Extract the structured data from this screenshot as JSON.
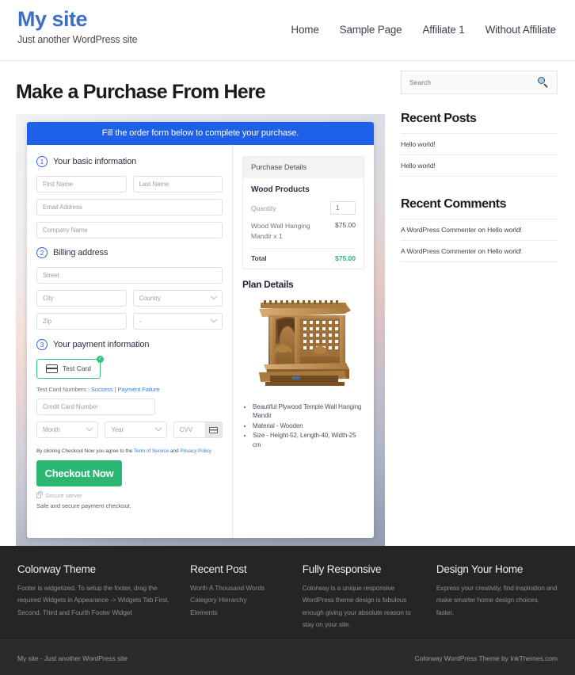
{
  "header": {
    "site_title": "My site",
    "tagline": "Just another WordPress site",
    "nav": [
      {
        "label": "Home"
      },
      {
        "label": "Sample Page"
      },
      {
        "label": "Affiliate 1"
      },
      {
        "label": "Without Affiliate"
      }
    ]
  },
  "page": {
    "title": "Make a Purchase From Here"
  },
  "form": {
    "banner": "Fill the order form below to complete your purchase.",
    "step1": {
      "number": "1",
      "label": "Your basic information",
      "first_name_placeholder": "First Name",
      "last_name_placeholder": "Last Name",
      "email_placeholder": "Email Address",
      "company_placeholder": "Company Name"
    },
    "step2": {
      "number": "2",
      "label": "Billing address",
      "street_placeholder": "Street",
      "city_placeholder": "City",
      "country_placeholder": "Country",
      "zip_placeholder": "Zip",
      "state_placeholder": "-"
    },
    "step3": {
      "number": "3",
      "label": "Your payment information",
      "card_tab_label": "Test Card",
      "card_tab_check": "✓",
      "test_numbers_prefix": "Test Card Numbers : ",
      "test_success": "Success",
      "test_divider": " | ",
      "test_failure": "Payment Failure",
      "card_number_placeholder": "Credit Card Number",
      "month_placeholder": "Month",
      "year_placeholder": "Year",
      "cvv_placeholder": "CVV",
      "agree_prefix": "By clicking Checkout Now you agree to the ",
      "agree_tos": "Term of Service",
      "agree_mid": " and ",
      "agree_privacy": "Privacy Policy",
      "checkout_button": "Checkout Now",
      "secure_server": "Secure server",
      "safe_note": "Safe and secure payment checkout."
    }
  },
  "purchase": {
    "head": "Purchase Details",
    "product": "Wood Products",
    "quantity_label": "Quantity",
    "quantity_value": "1",
    "item_name": "Wood Wall Hanging Mandir x 1",
    "item_price": "$75.00",
    "total_label": "Total",
    "total_value": "$75.00",
    "plan_title": "Plan Details",
    "bullets": [
      "Beautiful Plywood Temple Wall Hanging Mandir",
      "Material - Wooden",
      "Size - Height-52, Length-40, Width-25 cm"
    ]
  },
  "sidebar": {
    "search_placeholder": "Search",
    "recent_posts_title": "Recent Posts",
    "recent_posts": [
      {
        "label": "Hello world!"
      },
      {
        "label": "Hello world!"
      }
    ],
    "recent_comments_title": "Recent Comments",
    "recent_comments": [
      {
        "author": "A WordPress Commenter",
        "on": " on ",
        "post": "Hello world!"
      },
      {
        "author": "A WordPress Commenter",
        "on": " on ",
        "post": "Hello world!"
      }
    ]
  },
  "footer": {
    "columns": [
      {
        "title": "Colorway Theme",
        "text": "Footer is widgetized. To setup the footer, drag the required Widgets in Appearance -> Widgets Tab First, Second, Third and Fourth Footer Widget"
      },
      {
        "title": "Recent Post",
        "items": [
          {
            "label": "Worth A Thousand Words"
          },
          {
            "label": "Category Hierarchy"
          },
          {
            "label": "Elements"
          }
        ]
      },
      {
        "title": "Fully Responsive",
        "text": "Colorway is a unique responsive WordPress theme design is fabulous enough giving your absolute reason to stay on your site."
      },
      {
        "title": "Design Your Home",
        "text": "Express your creativity, find inspiration and make smarter home design choices, faster."
      }
    ],
    "bottom_left": "My site - Just another WordPress site",
    "bottom_right": "Colorway WordPress Theme by InkThemes.com"
  },
  "colors": {
    "brand": "#3f6fc4",
    "banner_blue": "#1f60e8",
    "accent_green": "#2bb673",
    "link_blue": "#3f7fd6",
    "footer_bg": "#252525"
  }
}
